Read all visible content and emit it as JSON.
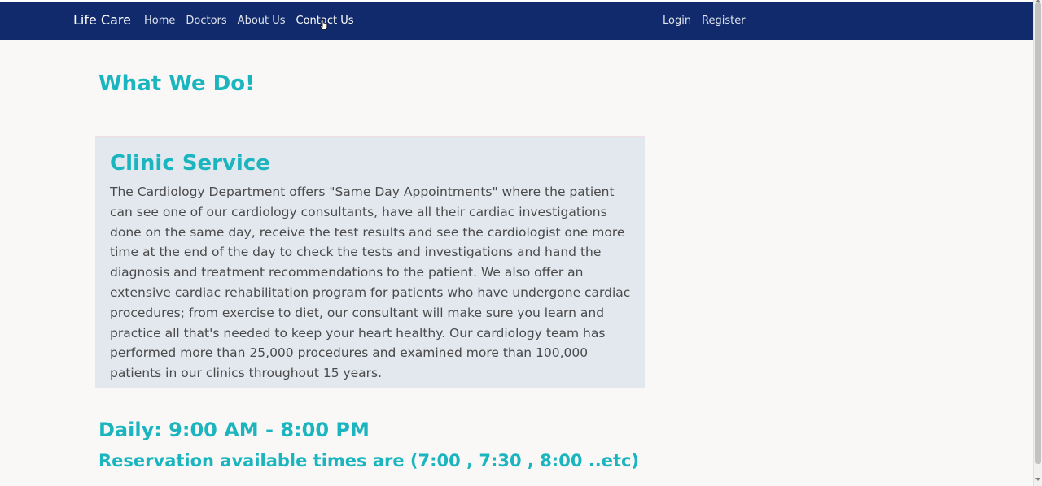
{
  "navbar": {
    "brand": "Life Care",
    "links": [
      "Home",
      "Doctors",
      "About Us",
      "Contact Us"
    ],
    "auth": [
      "Login",
      "Register"
    ],
    "background_color": "#102a6b"
  },
  "main": {
    "title": "What We Do!",
    "service": {
      "title": "Clinic Service",
      "body": "The Cardiology Department offers \"Same Day Appointments\" where the patient can see one of our cardiology consultants, have all their cardiac investigations done on the same day, receive the test results and see the cardiologist one more time at the end of the day to check the tests and investigations and hand the diagnosis and treatment recommendations to the patient. We also offer an extensive cardiac rehabilitation program for patients who have undergone cardiac procedures; from exercise to diet, our consultant will make sure you learn and practice all that's needed to keep your heart healthy. Our cardiology team has performed more than 25,000 procedures and examined more than 100,000 patients in our clinics throughout 15 years."
    },
    "hours": "Daily: 9:00 AM - 8:00 PM",
    "reservation": "Reservation available times are (7:00 , 7:30 , 8:00 ..etc)"
  },
  "colors": {
    "accent": "#1ab5bf",
    "card_background": "#e3e8ef",
    "page_background": "#faf8f6"
  },
  "icons": {
    "cursor": "hand-pointer-icon"
  }
}
